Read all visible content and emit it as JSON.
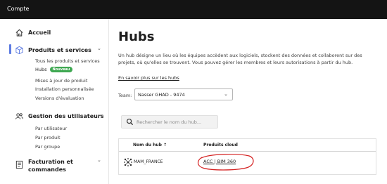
{
  "topbar": {
    "title": "Compte"
  },
  "sidebar": {
    "home": {
      "label": "Accueil",
      "icon": "home-icon"
    },
    "products": {
      "label": "Produits et services",
      "icon": "cube-icon",
      "items": [
        {
          "label": "Tous les produits et services"
        },
        {
          "label": "Hubs",
          "badge": "Nouveau"
        },
        {
          "label": "Mises à jour de produit"
        },
        {
          "label": "Installation personnalisée"
        },
        {
          "label": "Versions d'évaluation"
        }
      ]
    },
    "users": {
      "label": "Gestion des utilisateurs",
      "icon": "users-icon",
      "items": [
        {
          "label": "Par utilisateur"
        },
        {
          "label": "Par produit"
        },
        {
          "label": "Par groupe"
        }
      ]
    },
    "billing": {
      "label_line1": "Facturation et",
      "label_line2": "commandes",
      "icon": "billing-icon"
    }
  },
  "main": {
    "title": "Hubs",
    "description": "Un hub désigne un lieu où les équipes accèdent aux logiciels, stockent des données et collaborent sur des projets, où qu'elles se trouvent. Vous pouvez gérer les membres et leurs autorisations à partir du hub.",
    "learn_more": "En savoir plus sur les hubs",
    "team_label": "Team:",
    "team_value": "Nasser GHAD - 9474",
    "search_placeholder": "Rechercher le nom du hub...",
    "table": {
      "columns": [
        "Nom du hub ↑",
        "Produits cloud"
      ],
      "rows": [
        {
          "name": "MAM_FRANCE",
          "cloud": "ACC | BIM 360"
        }
      ]
    }
  },
  "colors": {
    "topbar": "#141414",
    "accent": "#5e7ce2",
    "badge": "#3fa852",
    "annotation": "#d42020"
  }
}
